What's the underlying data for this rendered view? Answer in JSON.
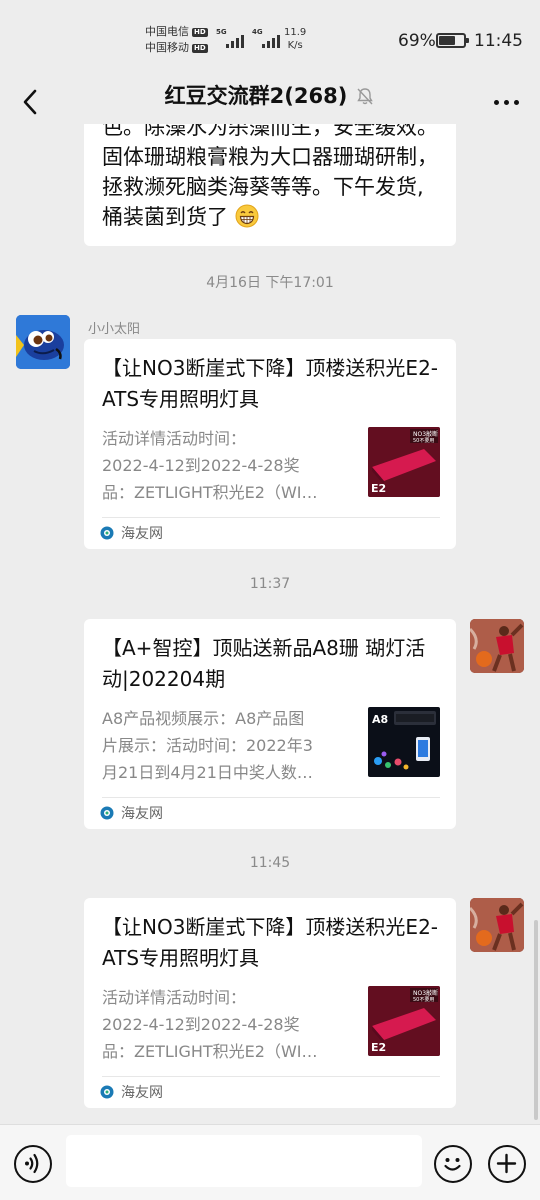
{
  "status_bar": {
    "carrier1": "中国电信",
    "carrier2": "中国移动",
    "hd": "HD",
    "sim1_tag": "5G",
    "sim2_tag": "4G",
    "speed_value": "11.9",
    "speed_unit": "K/s",
    "battery": "69%",
    "battery_level": 0.69,
    "time": "11:45"
  },
  "nav": {
    "title": "红豆交流群2(268)",
    "back_icon": "chevron-left-icon",
    "mute_icon": "bell-off-icon",
    "more_icon": "more-horizontal-icon"
  },
  "messages": {
    "partial_text": "色。除藻水为杀藻而生，安全缓效。固体珊瑚粮膏粮为大口器珊瑚研制，拯救濒死脑类海葵等等。下午发货,桶装菌到货了",
    "time1": "4月16日 下午17:01",
    "sender1": "小小太阳",
    "card1": {
      "title": "【让NO3断崖式下降】顶楼送积光E2-ATS专用照明灯具",
      "desc1": "活动详情活动时间：",
      "desc2": "2022-4-12到2022-4-28奖",
      "desc3": "品：ZETLIGHT积光E2（WI…",
      "source": "海友网",
      "thumb_top": "NO3敲断",
      "thumb_sub": "50不要用",
      "thumb_label": "E2"
    },
    "time2": "11:37",
    "card2": {
      "title": "【A+智控】顶贴送新品A8珊 瑚灯活动|202204期",
      "desc1": "A8产品视频展示：A8产品图",
      "desc2": "片展示：活动时间：2022年3",
      "desc3": "月21日到4月21日中奖人数…",
      "source": "海友网",
      "thumb_label": "A8"
    },
    "time3": "11:45",
    "card3": {
      "title": "【让NO3断崖式下降】顶楼送积光E2-ATS专用照明灯具",
      "desc1": "活动详情活动时间：",
      "desc2": "2022-4-12到2022-4-28奖",
      "desc3": "品：ZETLIGHT积光E2（WI…",
      "source": "海友网",
      "thumb_top": "NO3敲断",
      "thumb_sub": "50不要用",
      "thumb_label": "E2"
    }
  },
  "input_bar": {
    "voice_icon": "voice-icon",
    "emoji_icon": "emoji-icon",
    "plus_icon": "plus-icon",
    "input_value": ""
  },
  "colors": {
    "background": "#ededed",
    "bubble": "#ffffff",
    "timestamp": "#8a8a8a"
  }
}
